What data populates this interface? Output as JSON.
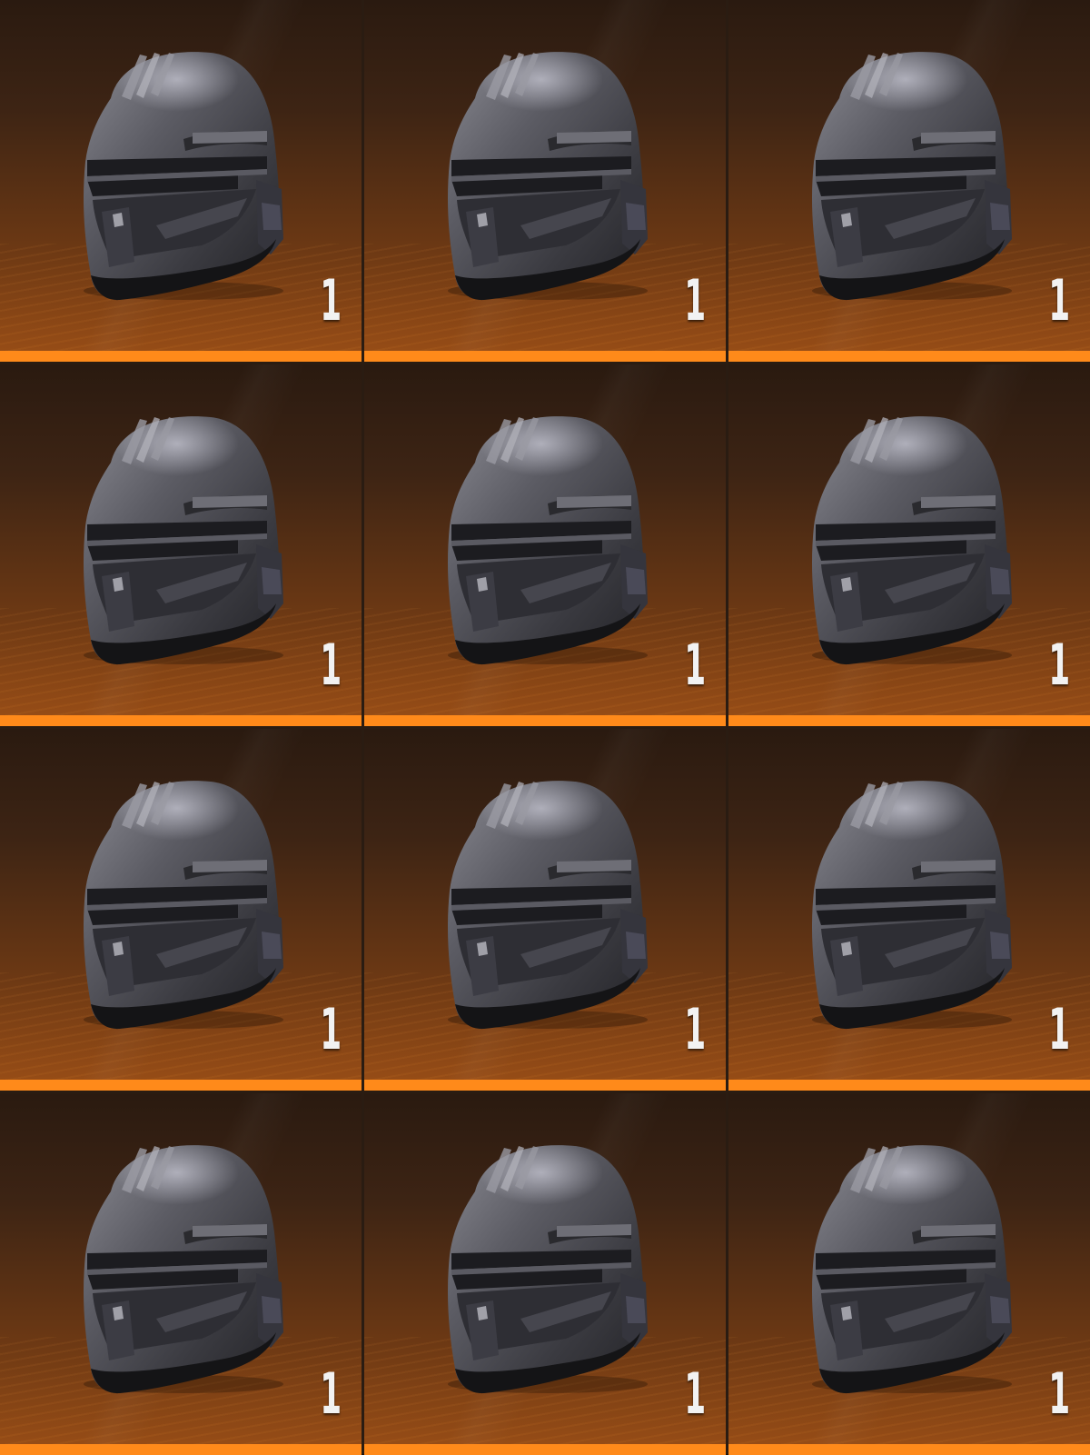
{
  "inventory": {
    "rarity_color": "#ff8a1a",
    "slots": [
      {
        "item_icon": "helmet-icon",
        "quantity": "1"
      },
      {
        "item_icon": "helmet-icon",
        "quantity": "1"
      },
      {
        "item_icon": "helmet-icon",
        "quantity": "1"
      },
      {
        "item_icon": "helmet-icon",
        "quantity": "1"
      },
      {
        "item_icon": "helmet-icon",
        "quantity": "1"
      },
      {
        "item_icon": "helmet-icon",
        "quantity": "1"
      },
      {
        "item_icon": "helmet-icon",
        "quantity": "1"
      },
      {
        "item_icon": "helmet-icon",
        "quantity": "1"
      },
      {
        "item_icon": "helmet-icon",
        "quantity": "1"
      },
      {
        "item_icon": "helmet-icon",
        "quantity": "1"
      },
      {
        "item_icon": "helmet-icon",
        "quantity": "1"
      },
      {
        "item_icon": "helmet-icon",
        "quantity": "1"
      }
    ]
  }
}
